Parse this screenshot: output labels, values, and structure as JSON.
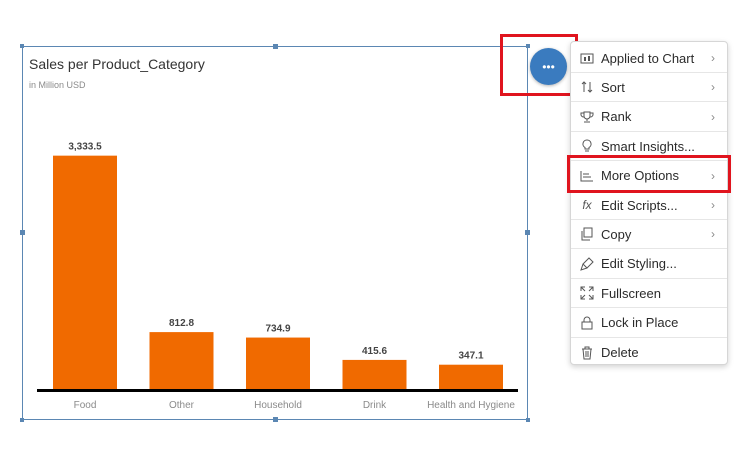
{
  "widget": {
    "title": "Sales per Product_Category",
    "subtitle": "in Million USD"
  },
  "chart_data": {
    "type": "bar",
    "title": "Sales per Product_Category",
    "subtitle": "in Million USD",
    "categories": [
      "Food",
      "Other",
      "Household",
      "Drink",
      "Health and Hygiene"
    ],
    "values": [
      3333.5,
      812.8,
      734.9,
      415.6,
      347.1
    ],
    "value_labels": [
      "3,333.5",
      "812.8",
      "734.9",
      "415.6",
      "347.1"
    ],
    "ylim": [
      0,
      3600
    ],
    "bar_color": "#f06a00",
    "grid": false
  },
  "more_button": {
    "label": "•••",
    "color": "#3a7bbf"
  },
  "menu": {
    "items": [
      {
        "label": "Applied to Chart",
        "icon": "chart-filter-icon",
        "submenu": true
      },
      {
        "label": "Sort",
        "icon": "sort-icon",
        "submenu": true
      },
      {
        "label": "Rank",
        "icon": "trophy-icon",
        "submenu": true
      },
      {
        "label": "Smart Insights...",
        "icon": "lightbulb-icon",
        "submenu": false
      },
      {
        "label": "More Options",
        "icon": "options-list-icon",
        "submenu": true
      },
      {
        "label": "Edit Scripts...",
        "icon": "fx-icon",
        "submenu": true
      },
      {
        "label": "Copy",
        "icon": "copy-icon",
        "submenu": true
      },
      {
        "label": "Edit Styling...",
        "icon": "paint-brush-icon",
        "submenu": false
      },
      {
        "label": "Fullscreen",
        "icon": "fullscreen-icon",
        "submenu": false
      },
      {
        "label": "Lock in Place",
        "icon": "lock-icon",
        "submenu": false
      },
      {
        "label": "Delete",
        "icon": "trash-icon",
        "submenu": false
      }
    ],
    "chevron": "›"
  },
  "highlight_color": "#e0141e"
}
